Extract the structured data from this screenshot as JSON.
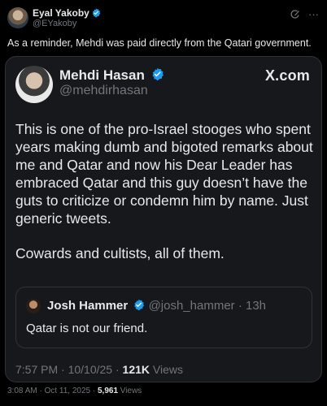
{
  "post": {
    "author_name": "Eyal Yakoby",
    "author_handle": "@EYakoby",
    "text": "As a reminder, Mehdi was paid directly from the Qatari government.",
    "timestamp": "3:08 AM · Oct 11, 2025 · ",
    "views_count": "5,961",
    "views_label": " Views"
  },
  "quote": {
    "name": "Mehdi Hasan",
    "handle": "@mehdirhasan",
    "source": "X.com",
    "paragraph1": "This is one of the pro-Israel stooges who spent years making dumb and bigoted remarks about me and Qatar and now his Dear Leader has embraced Qatar and this guy doesn’t have the guts to criticize or condemn him by name. Just generic tweets.",
    "paragraph2": "Cowards and cultists, all of them.",
    "timestamp": "7:57 PM · 10/10/25 · ",
    "views_count": "121K",
    "views_label": " Views"
  },
  "nested": {
    "name": "Josh Hammer",
    "meta": "@josh_hammer · 13h",
    "text": "Qatar is not our friend."
  },
  "icons": [
    "verified-badge-icon",
    "grok-icon",
    "more-icon"
  ],
  "colors": {
    "background": "#000000",
    "card": "#16181c",
    "border": "#2f3336",
    "text": "#e7e9ea",
    "muted": "#71767b",
    "verified": "#1d9bf0"
  }
}
